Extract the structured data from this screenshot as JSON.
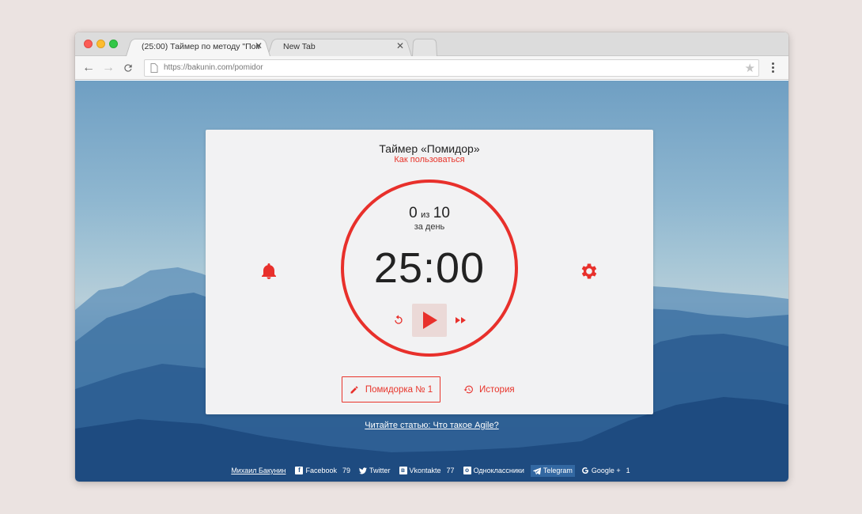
{
  "browser": {
    "tabs": [
      {
        "title": "(25:00) Таймер по методу \"Помид..",
        "active": true
      },
      {
        "title": "New Tab",
        "active": false
      }
    ],
    "url": "https://bakunin.com/pomidor"
  },
  "app": {
    "title": "Таймер «Помидор»",
    "help_link": "Как пользоваться",
    "done_count": "0",
    "of_word": "из",
    "goal_count": "10",
    "per_day": "за день",
    "time": "25:00",
    "task_label": "Помидорка № 1",
    "history_label": "История",
    "accent_color": "#e8342a"
  },
  "article_link": "Читайте статью: Что такое Agile?",
  "footer": {
    "author": "Михаил Бакунин",
    "social": [
      {
        "name": "Facebook",
        "count": "79",
        "icon": "facebook-icon"
      },
      {
        "name": "Twitter",
        "count": "",
        "icon": "twitter-icon"
      },
      {
        "name": "Vkontakte",
        "count": "77",
        "icon": "vk-icon"
      },
      {
        "name": "Одноклассники",
        "count": "",
        "icon": "odnoklassniki-icon"
      },
      {
        "name": "Telegram",
        "count": "",
        "icon": "telegram-icon"
      },
      {
        "name": "Google +",
        "count": "1",
        "icon": "google-plus-icon"
      }
    ]
  }
}
